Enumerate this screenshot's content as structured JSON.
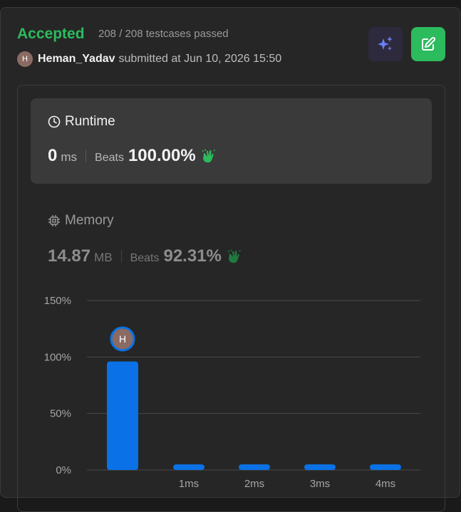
{
  "submission": {
    "status": "Accepted",
    "testcases": "208 / 208 testcases passed",
    "avatar_initial": "H",
    "username": "Heman_Yadav",
    "submitted_text": "submitted at Jun 10, 2026 15:50"
  },
  "runtime": {
    "title": "Runtime",
    "value": "0",
    "unit": "ms",
    "beats_label": "Beats",
    "beats_value": "100.00%"
  },
  "memory": {
    "title": "Memory",
    "value": "14.87",
    "unit": "MB",
    "beats_label": "Beats",
    "beats_value": "92.31%"
  },
  "colors": {
    "accepted": "#2cbb5d",
    "bar": "#0a72e6",
    "clap": "#2cbb5d"
  },
  "chart_data": {
    "type": "bar",
    "categories": [
      "",
      "1ms",
      "2ms",
      "3ms",
      "4ms"
    ],
    "values": [
      96,
      5,
      5,
      5,
      5
    ],
    "ylim": [
      0,
      150
    ],
    "yticks": [
      "0%",
      "50%",
      "100%",
      "150%"
    ],
    "ytick_values": [
      0,
      50,
      100,
      150
    ],
    "marker_initial": "H",
    "marker_category_index": 0,
    "grid": true,
    "title": "",
    "xlabel": "",
    "ylabel": ""
  }
}
